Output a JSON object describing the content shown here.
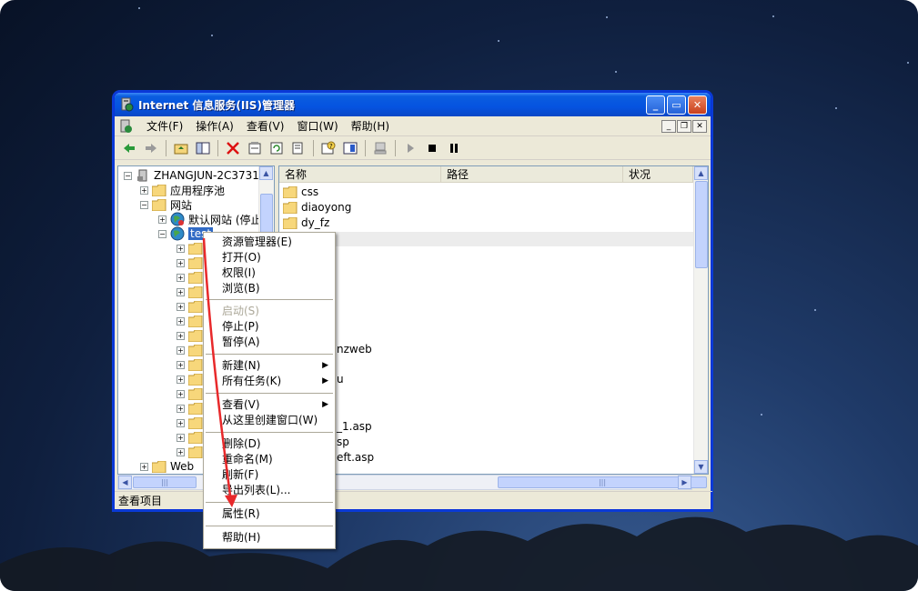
{
  "window": {
    "title": "Internet 信息服务(IIS)管理器"
  },
  "menubar": {
    "items": [
      "文件(F)",
      "操作(A)",
      "查看(V)",
      "窗口(W)",
      "帮助(H)"
    ]
  },
  "toolbar": {
    "icons": [
      "back-icon",
      "forward-icon",
      "up-folder-icon",
      "show-tree-icon",
      "delete-icon",
      "properties-icon",
      "refresh-icon",
      "export-icon",
      "help-icon",
      "console-icon",
      "computer-icon",
      "start-icon",
      "stop-icon",
      "pause-icon"
    ]
  },
  "tree": {
    "root": "ZHANGJUN-2C3731(",
    "app_pools": "应用程序池",
    "websites": "网站",
    "default_site": "默认网站 (停止",
    "selected_site": "test",
    "web_ext": "Web"
  },
  "list": {
    "columns": [
      "名称",
      "路径",
      "状况"
    ],
    "items": [
      "css",
      "diaoyong",
      "dy_fz"
    ],
    "fragments": [
      "nzweb",
      "u",
      "_1.asp",
      "sp",
      "eft.asp"
    ]
  },
  "context_menu": {
    "items": [
      {
        "label": "资源管理器(E)",
        "disabled": false,
        "submenu": false
      },
      {
        "label": "打开(O)",
        "disabled": false,
        "submenu": false
      },
      {
        "label": "权限(I)",
        "disabled": false,
        "submenu": false
      },
      {
        "label": "浏览(B)",
        "disabled": false,
        "submenu": false
      },
      {
        "label": "启动(S)",
        "disabled": true,
        "submenu": false
      },
      {
        "label": "停止(P)",
        "disabled": false,
        "submenu": false
      },
      {
        "label": "暂停(A)",
        "disabled": false,
        "submenu": false
      },
      {
        "label": "新建(N)",
        "disabled": false,
        "submenu": true
      },
      {
        "label": "所有任务(K)",
        "disabled": false,
        "submenu": true
      },
      {
        "label": "查看(V)",
        "disabled": false,
        "submenu": true
      },
      {
        "label": "从这里创建窗口(W)",
        "disabled": false,
        "submenu": false
      },
      {
        "label": "删除(D)",
        "disabled": false,
        "submenu": false
      },
      {
        "label": "重命名(M)",
        "disabled": false,
        "submenu": false
      },
      {
        "label": "刷新(F)",
        "disabled": false,
        "submenu": false
      },
      {
        "label": "导出列表(L)...",
        "disabled": false,
        "submenu": false
      },
      {
        "label": "属性(R)",
        "disabled": false,
        "submenu": false
      },
      {
        "label": "帮助(H)",
        "disabled": false,
        "submenu": false
      }
    ]
  },
  "statusbar": {
    "text": "查看项目"
  },
  "colors": {
    "accent_arrow": "#e8292b",
    "selection": "#316ac5",
    "title_blue": "#0553e0"
  }
}
